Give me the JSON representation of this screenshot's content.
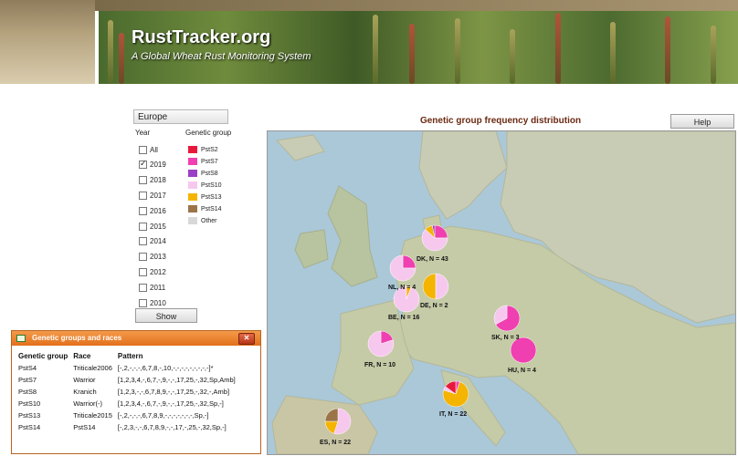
{
  "header": {
    "title": "RustTracker.org",
    "subtitle": "A Global Wheat Rust Monitoring System"
  },
  "filters": {
    "region": "Europe",
    "year_heading": "Year",
    "genetic_group_heading": "Genetic group",
    "years": [
      {
        "label": "All",
        "checked": false
      },
      {
        "label": "2019",
        "checked": true
      },
      {
        "label": "2018",
        "checked": false
      },
      {
        "label": "2017",
        "checked": false
      },
      {
        "label": "2016",
        "checked": false
      },
      {
        "label": "2015",
        "checked": false
      },
      {
        "label": "2014",
        "checked": false
      },
      {
        "label": "2013",
        "checked": false
      },
      {
        "label": "2012",
        "checked": false
      },
      {
        "label": "2011",
        "checked": false
      },
      {
        "label": "2010",
        "checked": false
      }
    ],
    "legend": [
      {
        "label": "PstS2",
        "color": "#e8183c"
      },
      {
        "label": "PstS7",
        "color": "#f03fb0"
      },
      {
        "label": "PstS8",
        "color": "#9b3fc8"
      },
      {
        "label": "PstS10",
        "color": "#f7c8ee"
      },
      {
        "label": "PstS13",
        "color": "#f4b400"
      },
      {
        "label": "PstS14",
        "color": "#9b7448"
      },
      {
        "label": "Other",
        "color": "#d8d8d8"
      }
    ],
    "show_label": "Show"
  },
  "map": {
    "title": "Genetic group frequency distribution",
    "help_label": "Help",
    "pies": [
      {
        "label": "DK, N = 43",
        "slices": [
          {
            "group": "PstS7",
            "value": 0.25
          },
          {
            "group": "PstS10",
            "value": 0.62
          },
          {
            "group": "PstS13",
            "value": 0.1
          },
          {
            "group": "PstS8",
            "value": 0.03
          }
        ]
      },
      {
        "label": "NL, N = 4",
        "slices": [
          {
            "group": "PstS7",
            "value": 0.25
          },
          {
            "group": "PstS10",
            "value": 0.75
          }
        ]
      },
      {
        "label": "DE, N = 2",
        "slices": [
          {
            "group": "PstS10",
            "value": 0.5
          },
          {
            "group": "PstS13",
            "value": 0.5
          }
        ]
      },
      {
        "label": "BE, N = 16",
        "slices": [
          {
            "group": "PstS13",
            "value": 0.06
          },
          {
            "group": "PstS10",
            "value": 0.94
          }
        ]
      },
      {
        "label": "SK, N = 3",
        "slices": [
          {
            "group": "PstS7",
            "value": 0.67
          },
          {
            "group": "PstS10",
            "value": 0.33
          }
        ]
      },
      {
        "label": "FR, N = 10",
        "slices": [
          {
            "group": "PstS7",
            "value": 0.2
          },
          {
            "group": "PstS10",
            "value": 0.8
          }
        ]
      },
      {
        "label": "HU, N = 4",
        "slices": [
          {
            "group": "PstS7",
            "value": 1.0
          }
        ]
      },
      {
        "label": "IT, N = 22",
        "slices": [
          {
            "group": "PstS7",
            "value": 0.05
          },
          {
            "group": "PstS13",
            "value": 0.75
          },
          {
            "group": "PstS10",
            "value": 0.05
          },
          {
            "group": "PstS2",
            "value": 0.15
          }
        ]
      },
      {
        "label": "ES, N = 22",
        "slices": [
          {
            "group": "PstS10",
            "value": 0.55
          },
          {
            "group": "PstS13",
            "value": 0.2
          },
          {
            "group": "PstS14",
            "value": 0.25
          }
        ]
      }
    ]
  },
  "dialog": {
    "title": "Genetic groups and races",
    "columns": [
      "Genetic group",
      "Race",
      "Pattern"
    ],
    "rows": [
      [
        "PstS4",
        "Triticale2006",
        "[-,2,-,-,-,6,7,8,-,10,-,-,-,-,-,-,-,-,-]*"
      ],
      [
        "PstS7",
        "Warrior",
        "[1,2,3,4,-,6,7,-,9,-,-,17,25,-,32,Sp,Amb]"
      ],
      [
        "PstS8",
        "Kranich",
        "[1,2,3,-,-,6,7,8,9,-,-,17,25,-,32,-,Amb]"
      ],
      [
        "PstS10",
        "Warrior(-)",
        "[1,2,3,4,-,6,7,-,9,-,-,17,25,-,32,Sp,-]"
      ],
      [
        "PstS13",
        "Triticale2015",
        "[-,2,-,-,-,6,7,8,9,-,-,-,-,-,-,-,Sp,-]"
      ],
      [
        "PstS14",
        "PstS14",
        "[-,2,3,-,-,6,7,8,9,-,-,17,-,25,-,32,Sp,-]"
      ]
    ]
  }
}
